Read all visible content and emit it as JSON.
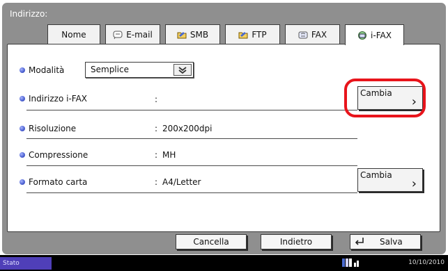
{
  "title": "Indirizzo:",
  "tabs": [
    {
      "label": "Nome",
      "icon": "none"
    },
    {
      "label": "E-mail",
      "icon": "email-icon"
    },
    {
      "label": "SMB",
      "icon": "folder-icon"
    },
    {
      "label": "FTP",
      "icon": "folder-icon"
    },
    {
      "label": "FAX",
      "icon": "fax-icon"
    },
    {
      "label": "i-FAX",
      "icon": "ifax-icon",
      "active": true
    }
  ],
  "settings": {
    "mode": {
      "label": "Modalità",
      "value": "Semplice"
    },
    "ifax_address": {
      "label": "Indirizzo i-FAX",
      "sep": ":",
      "value": ""
    },
    "resolution": {
      "label": "Risoluzione",
      "sep": ":",
      "value": "200x200dpi"
    },
    "compression": {
      "label": "Compressione",
      "sep": ":",
      "value": "MH"
    },
    "paper_format": {
      "label": "Formato carta",
      "sep": ":",
      "value": "A4/Letter"
    }
  },
  "buttons": {
    "change_label": "Cambia",
    "cancel": "Cancella",
    "back": "Indietro",
    "save": "Salva"
  },
  "status": {
    "label": "Stato",
    "date": "10/10/2010"
  },
  "colors": {
    "frame": "#8f8f8f",
    "highlight": "#e8141b",
    "status_label_bg": "#4f3fb8",
    "bullet": "#4a5fd0"
  }
}
